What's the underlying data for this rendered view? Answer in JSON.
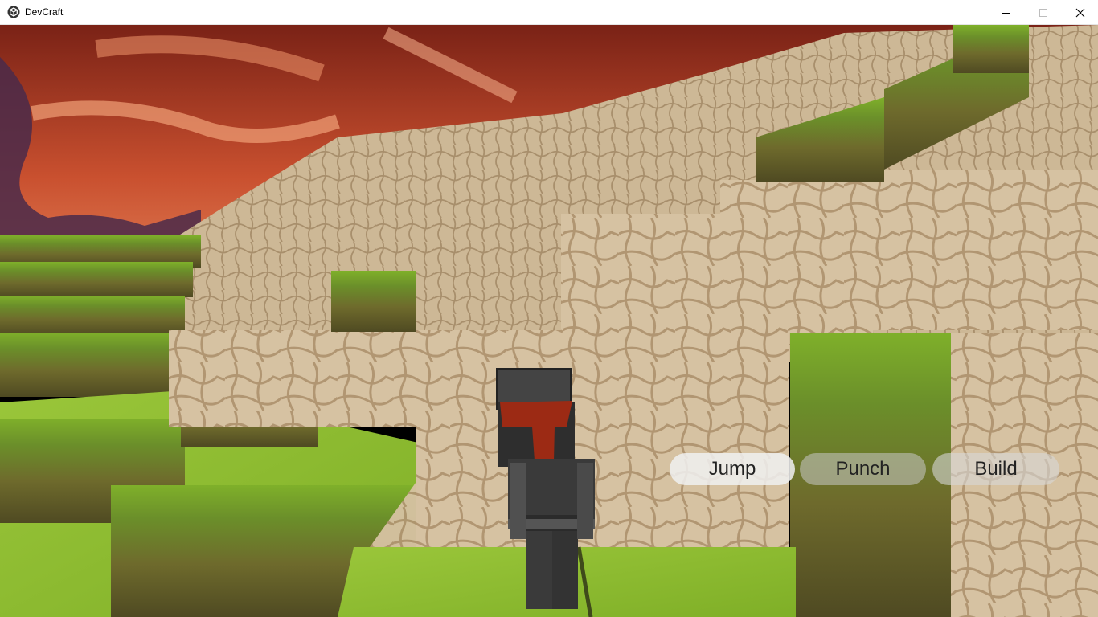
{
  "window": {
    "title": "DevCraft",
    "icon": "unity-cube-icon",
    "controls": [
      "minimize-icon",
      "maximize-icon",
      "close-icon"
    ]
  },
  "hud": {
    "jump_label": "Jump",
    "punch_label": "Punch",
    "build_label": "Build"
  },
  "scene": {
    "sky_colors": [
      "#8a2c1e",
      "#d9674a",
      "#f0a070"
    ],
    "grass_color": "#8fbf2f",
    "stone_color": "#d8c3a3",
    "player": "armored-character"
  }
}
